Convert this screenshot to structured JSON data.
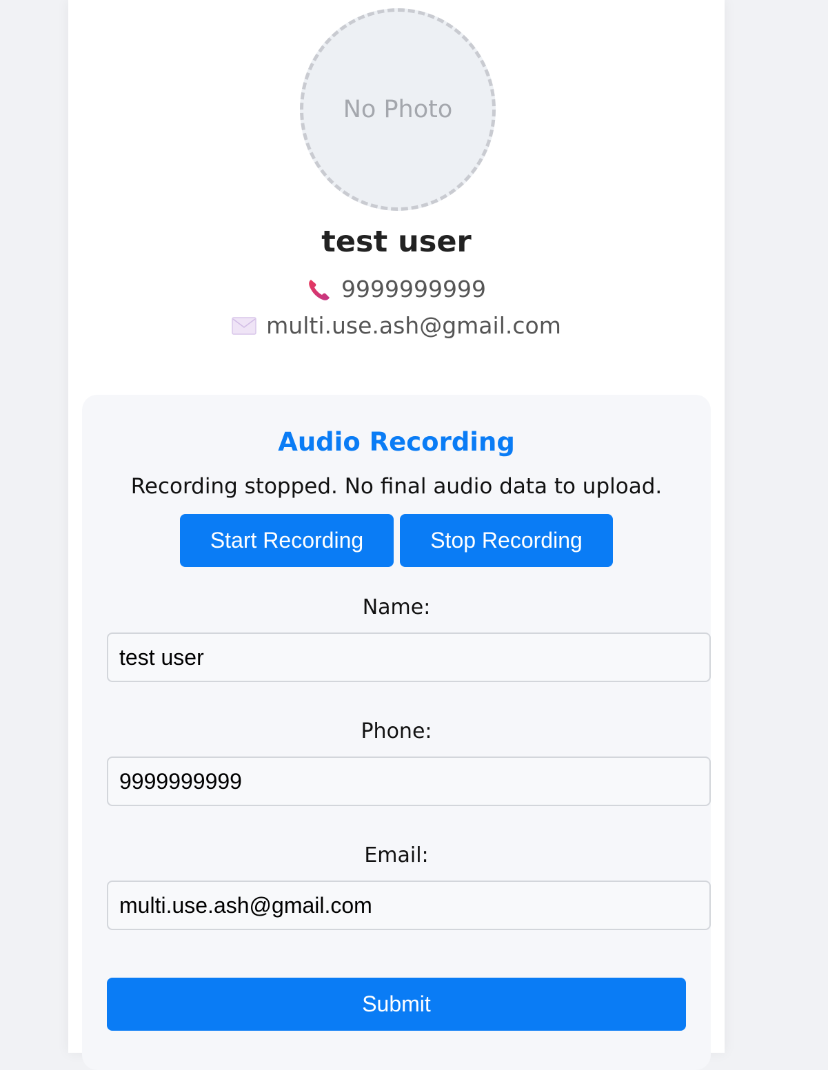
{
  "profile": {
    "photo_placeholder": "No Photo",
    "name": "test user",
    "phone": "9999999999",
    "email": "multi.use.ash@gmail.com",
    "phone_icon": "telephone-receiver-icon",
    "email_icon": "envelope-icon"
  },
  "recording": {
    "title": "Audio Recording",
    "status": "Recording stopped. No final audio data to upload.",
    "start_label": "Start Recording",
    "stop_label": "Stop Recording"
  },
  "form": {
    "name_label": "Name:",
    "name_value": "test user",
    "phone_label": "Phone:",
    "phone_value": "9999999999",
    "email_label": "Email:",
    "email_value": "multi.use.ash@gmail.com",
    "submit_label": "Submit"
  },
  "colors": {
    "accent": "#0a7cf5",
    "page_background": "#f1f2f5",
    "panel_background": "#f6f7fa"
  }
}
